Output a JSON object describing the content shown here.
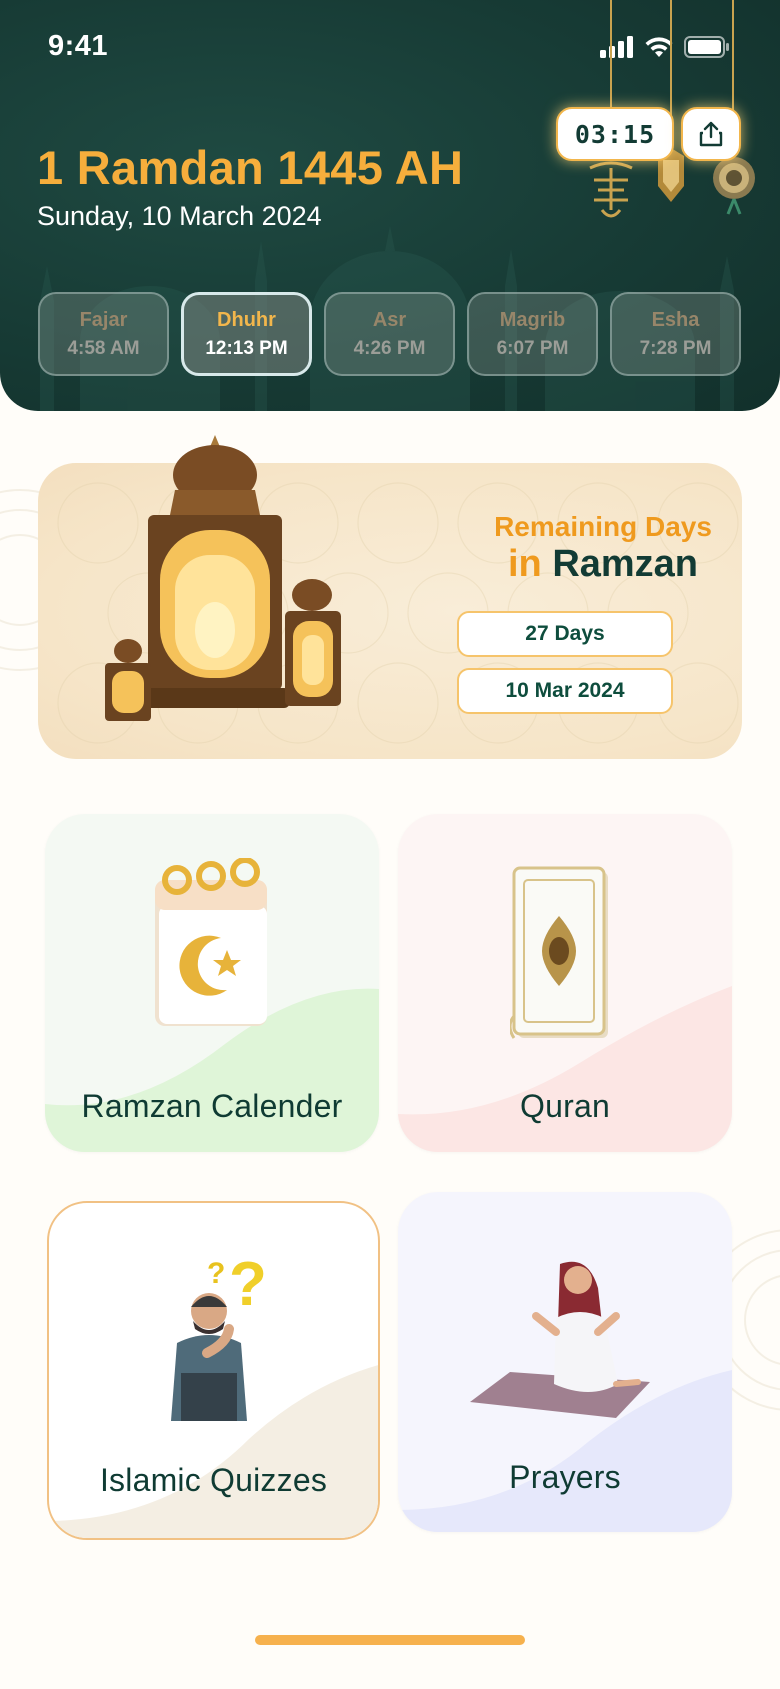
{
  "status_bar": {
    "time": "9:41"
  },
  "header": {
    "hijri_date": "1 Ramdan 1445 AH",
    "gregorian_date": "Sunday, 10 March 2024",
    "timer": "03:15"
  },
  "prayers": [
    {
      "name": "Fajar",
      "time": "4:58 AM",
      "active": false
    },
    {
      "name": "Dhuhr",
      "time": "12:13 PM",
      "active": true
    },
    {
      "name": "Asr",
      "time": "4:26 PM",
      "active": false
    },
    {
      "name": "Magrib",
      "time": "6:07 PM",
      "active": false
    },
    {
      "name": "Esha",
      "time": "7:28 PM",
      "active": false
    }
  ],
  "remaining": {
    "title": "Remaining Days",
    "in": "in",
    "ramzan": "Ramzan",
    "days": "27 Days",
    "date": "10 Mar 2024"
  },
  "tiles": {
    "calendar": "Ramzan Calender",
    "quran": "Quran",
    "quizzes": "Islamic Quizzes",
    "prayers": "Prayers"
  },
  "colors": {
    "header_bg": "#173b35",
    "accent_orange": "#f6ae3c",
    "text_dark": "#0f3b33"
  },
  "icons": [
    "signal-icon",
    "wifi-icon",
    "battery-icon",
    "share-icon",
    "lantern-icon",
    "calendar-icon",
    "quran-icon",
    "quiz-icon",
    "prayer-icon"
  ]
}
